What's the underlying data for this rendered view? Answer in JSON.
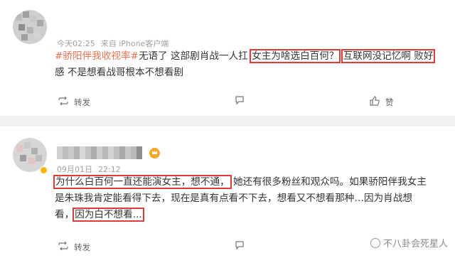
{
  "post1": {
    "meta": {
      "time": "今天02:25",
      "source": "来自 iPhone客户端"
    },
    "content": {
      "hashtag": "#骄阳伴我收视率#",
      "text1": "无语了 这部剧肖战一人扛 ",
      "highlight1": "女主为啥选白百何？",
      "highlight2": "互联网没记忆啊 败好",
      "line2": "感 不是想看战哥根本不想看剧"
    },
    "actions": {
      "repost": "转发",
      "like": "赞"
    }
  },
  "post2": {
    "meta": {
      "date": "09月01日",
      "time": "22:12"
    },
    "content": {
      "highlight1": "为什么白百何一直还能演女主，想不通，",
      "text1": "她还有很多粉丝和观众吗。如果骄阳伴我女主",
      "line2": "是朱珠我肯定能看得下去，现在是真有点看不下去，想看又不想看那种…因为肖战想",
      "line3_prefix": "看，",
      "highlight2": "因为白不想看..."
    },
    "actions": {
      "repost": "转发",
      "like": "赞"
    }
  },
  "watermark": "不八卦会死星人",
  "icons": [
    "avatar",
    "comment-icon",
    "repost-icon",
    "like-icon",
    "crown-badge",
    "verified-badge",
    "watermark-icon"
  ],
  "colors": {
    "hashtag": "#eb7350",
    "highlight_box": "#e03a3a",
    "divider": "#f2f2f2"
  }
}
